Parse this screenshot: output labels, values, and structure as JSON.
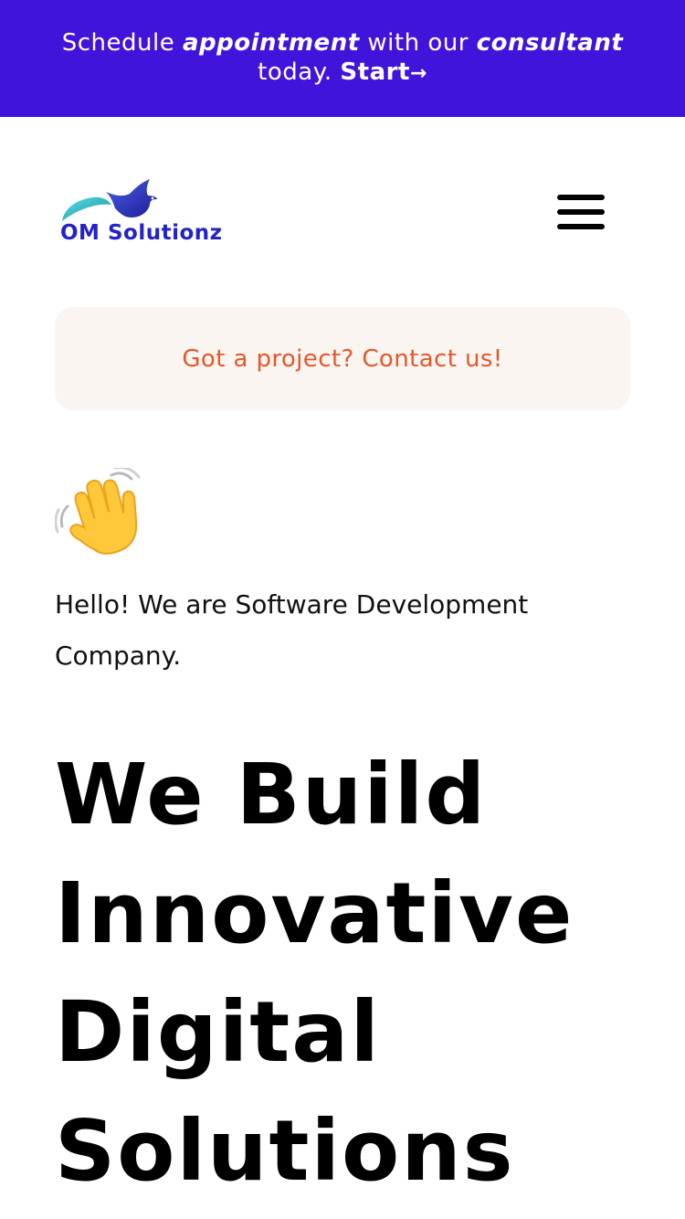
{
  "banner": {
    "part1": "Schedule ",
    "em1": "appointment",
    "part2": " with our ",
    "em2": "consultant",
    "part3": "today. ",
    "link": "Start",
    "arrow": "→"
  },
  "header": {
    "logo_text": "OM Solutionz",
    "menu_icon": "hamburger-menu-icon"
  },
  "cta": {
    "label": "Got a project? Contact us!"
  },
  "hero": {
    "emoji": "waving-hand-icon",
    "intro": "Hello! We are Software Development Company.",
    "headline": [
      "We Build",
      "Innovative",
      "Digital",
      "Solutions"
    ]
  },
  "colors": {
    "banner_bg": "#4114dc",
    "cta_bg": "#fbf5f1",
    "cta_text": "#e4582b",
    "logo_blue": "#2323c8",
    "logo_teal": "#21b1c4"
  }
}
